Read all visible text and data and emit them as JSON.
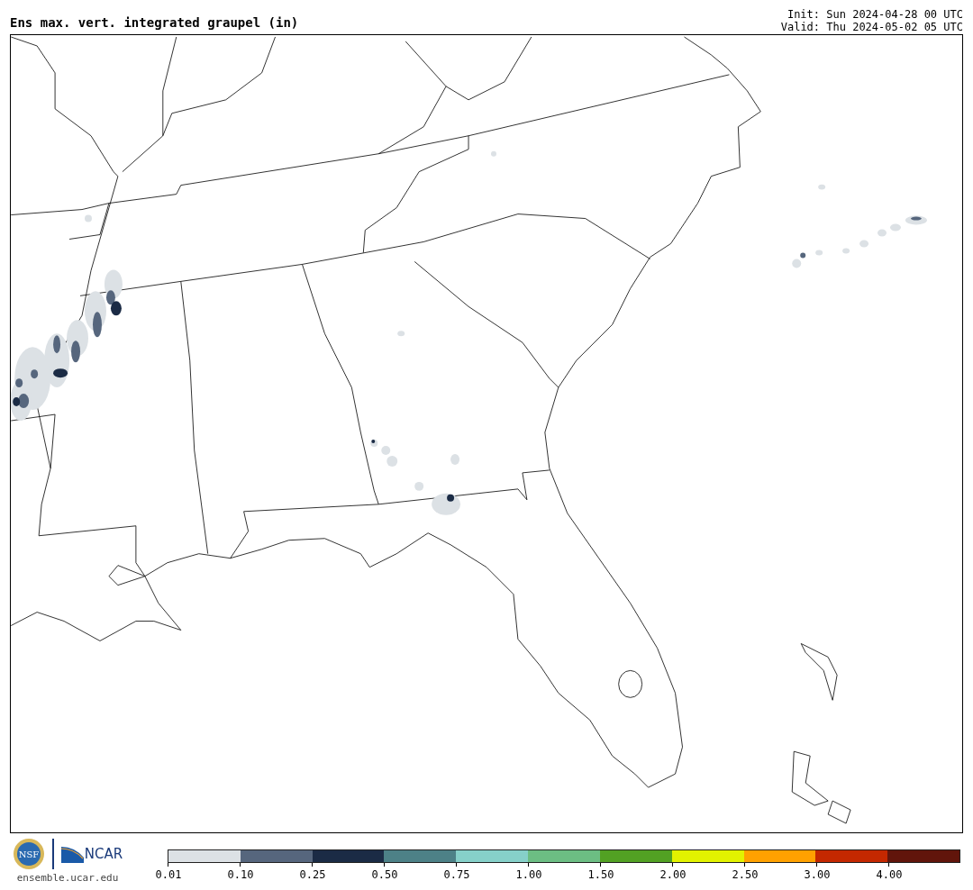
{
  "title": "Ens max. vert. integrated graupel (in)",
  "init": "Init: Sun 2024-04-28 00 UTC",
  "valid": "Valid: Thu 2024-05-02 05 UTC",
  "footer": {
    "nsf_logo_text": "NSF",
    "ncar_logo_text": "NCAR",
    "url": "ensemble.ucar.edu"
  },
  "colorbar": {
    "bins": [
      {
        "label": "0.01",
        "color": "#dce1e5"
      },
      {
        "label": "0.10",
        "color": "#56667d"
      },
      {
        "label": "0.25",
        "color": "#1b2b45"
      },
      {
        "label": "0.50",
        "color": "#4d8187"
      },
      {
        "label": "0.75",
        "color": "#86d0c9"
      },
      {
        "label": "1.00",
        "color": "#6cbd83"
      },
      {
        "label": "1.50",
        "color": "#52a123"
      },
      {
        "label": "2.00",
        "color": "#e2f200"
      },
      {
        "label": "2.50",
        "color": "#ffa100"
      },
      {
        "label": "3.00",
        "color": "#c42800"
      },
      {
        "label": "4.00",
        "color": "#61150b"
      }
    ]
  }
}
